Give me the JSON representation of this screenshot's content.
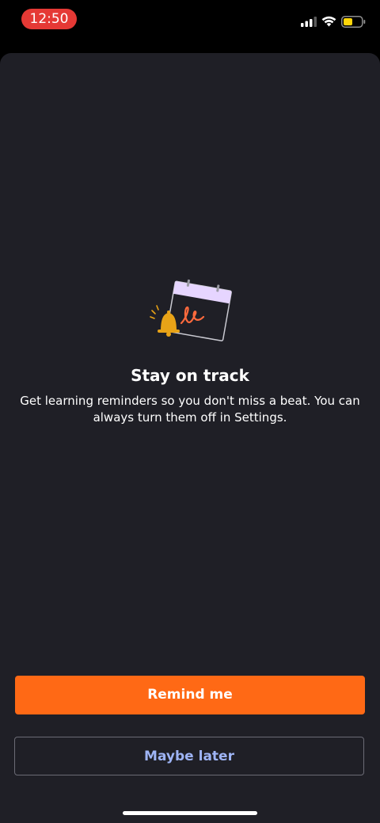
{
  "status_bar": {
    "time": "12:50",
    "icons": [
      "cellular-signal-icon",
      "wifi-icon",
      "battery-icon"
    ],
    "time_pill_color": "#E53935",
    "battery_fill_color": "#FFD60A"
  },
  "illustration": {
    "icon": "calendar-reminder-illustration",
    "bell_color": "#E8A317",
    "calendar_header_color": "#E6D5FF",
    "scribble_color": "#FF6A3D"
  },
  "content": {
    "title": "Stay on track",
    "body": "Get learning reminders so you don't miss a beat. You can always turn them off in Settings."
  },
  "actions": {
    "primary_label": "Remind me",
    "secondary_label": "Maybe later",
    "primary_color": "#FF6915",
    "secondary_text_color": "#9EB4F5"
  }
}
